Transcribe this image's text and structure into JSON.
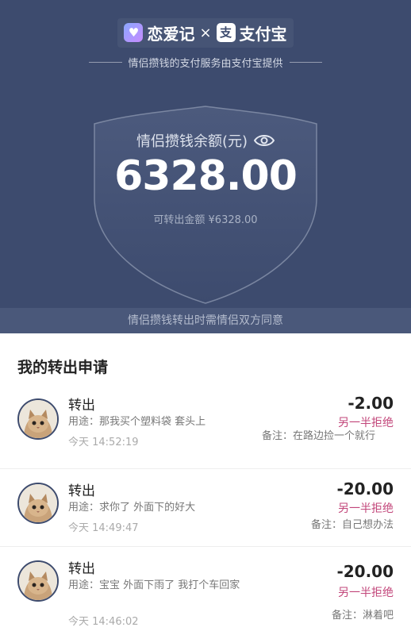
{
  "header": {
    "brand_left": "恋爱记",
    "brand_sep": "×",
    "brand_right": "支付宝",
    "subtitle": "情侣攒钱的支付服务由支付宝提供",
    "balance_label": "情侣攒钱余额(元)",
    "balance_amount": "6328.00",
    "available": "可转出金额 ¥6328.00",
    "notice": "情侣攒钱转出时需情侣双方同意"
  },
  "section_title": "我的转出申请",
  "requests": [
    {
      "type": "转出",
      "purpose": "用途：那我买个塑料袋 套头上",
      "time": "今天 14:52:19",
      "amount": "-2.00",
      "status": "另一半拒绝",
      "note": "备注：在路边捡一个就行"
    },
    {
      "type": "转出",
      "purpose": "用途：求你了 外面下的好大",
      "time": "今天 14:49:47",
      "amount": "-20.00",
      "status": "另一半拒绝",
      "note": "备注：自己想办法"
    },
    {
      "type": "转出",
      "purpose": "用途：宝宝 外面下雨了 我打个车回家",
      "time": "今天 14:46:02",
      "amount": "-20.00",
      "status": "另一半拒绝",
      "note": "备注：淋着吧"
    }
  ],
  "colors": {
    "header_bg": "#3d4b6e",
    "status_reject": "#c2467a"
  },
  "icons": [
    "love-app-logo-icon",
    "alipay-logo-icon",
    "eye-icon",
    "cat-avatar"
  ]
}
